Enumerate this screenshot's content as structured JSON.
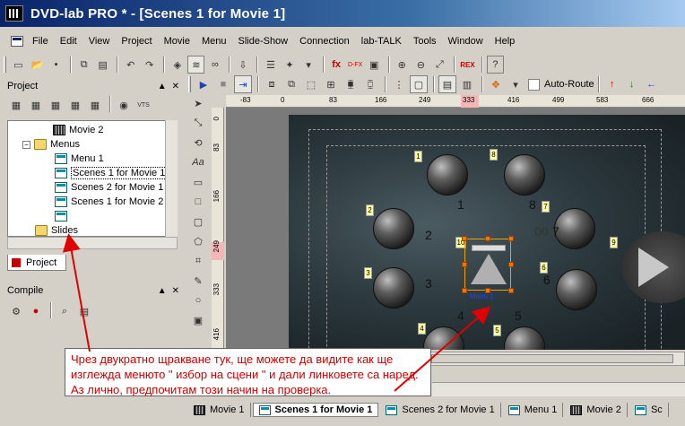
{
  "window": {
    "title": "DVD-lab PRO * - [Scenes 1 for Movie 1]"
  },
  "menubar": [
    "File",
    "Edit",
    "View",
    "Project",
    "Movie",
    "Menu",
    "Slide-Show",
    "Connection",
    "lab-TALK",
    "Tools",
    "Window",
    "Help"
  ],
  "toolbar": {
    "autoroute_label": "Auto-Route",
    "dfx_label": "D-FX",
    "rex_label": "REX"
  },
  "project_panel": {
    "title": "Project",
    "tree": [
      {
        "label": "Movie 2",
        "icon": "film-icon"
      },
      {
        "label": "Menus",
        "icon": "folder-icon"
      },
      {
        "label": "Menu 1",
        "icon": "menu-icon"
      },
      {
        "label": "Scenes 1 for Movie 1",
        "icon": "menu-icon",
        "selected": true
      },
      {
        "label": "Scenes 2 for Movie 1",
        "icon": "menu-icon"
      },
      {
        "label": "Scenes 1 for Movie 2",
        "icon": "menu-icon"
      },
      {
        "label": "",
        "icon": "menu-icon"
      },
      {
        "label": "Slides",
        "icon": "folder-icon"
      }
    ],
    "tab_label": "Project"
  },
  "compile_panel": {
    "title": "Compile"
  },
  "ruler": {
    "horizontal": [
      "-83",
      "0",
      "83",
      "166",
      "249",
      "333",
      "416",
      "499",
      "583",
      "666"
    ],
    "vertical": [
      "0",
      "83",
      "166",
      "249",
      "333",
      "416"
    ]
  },
  "canvas": {
    "badges": [
      "1",
      "8",
      "2",
      "7",
      "3",
      "6",
      "4",
      "5",
      "9",
      "10"
    ],
    "button_numbers": [
      "1",
      "8",
      "2",
      "7",
      "3",
      "6",
      "4",
      "5",
      "00",
      "07"
    ],
    "selected_button_label": "Menu 1"
  },
  "doc_tabs": [
    {
      "label": "Movie 1",
      "active": false
    },
    {
      "label": "Scenes 1 for Movie 1",
      "active": true
    },
    {
      "label": "Scenes 2 for Movie 1",
      "active": false
    },
    {
      "label": "Menu 1",
      "active": false
    },
    {
      "label": "Movie 2",
      "active": false
    },
    {
      "label": "Sc",
      "active": false
    }
  ],
  "callout": {
    "text": "Чрез двукратно щракване тук, ще можете да видите как ще изглежда менюто \" избор на сцени \" и дали линковете са наред. Аз лично, предпочитам този начин на проверка."
  },
  "colors": {
    "titlebar": "#0a246a",
    "callout_text": "#cc0000",
    "selection_handles": "#f07800",
    "button_label": "#2040ff"
  }
}
